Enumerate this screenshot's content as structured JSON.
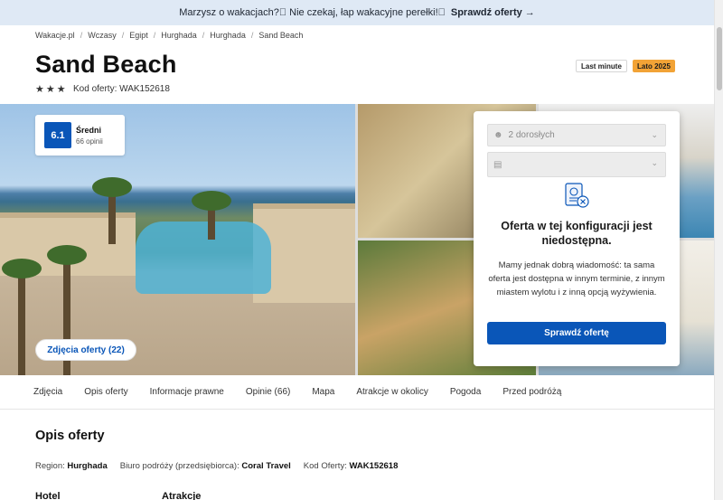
{
  "promo": {
    "text": "Marzysz o wakacjach?\u0000 Nie czekaj, łap wakacyjne perełki!\u0000",
    "link": "Sprawdź oferty →"
  },
  "breadcrumbs": [
    "Wakacje.pl",
    "Wczasy",
    "Egipt",
    "Hurghada",
    "Hurghada",
    "Sand Beach"
  ],
  "hotel": {
    "name": "Sand Beach",
    "stars": 3,
    "offer_code": "Kod oferty: WAK152618"
  },
  "tags": {
    "last_minute": "Last minute",
    "season": "Lato 2025"
  },
  "rating": {
    "score": "6.1",
    "label": "Średni",
    "count": "66 opinii"
  },
  "photos_button": "Zdjęcia oferty (22)",
  "panel": {
    "guests": "2 dorosłych",
    "date": "",
    "unavailable_title": "Oferta w tej konfiguracji jest niedostępna.",
    "unavailable_body": "Mamy jednak dobrą wiadomość: ta sama oferta jest dostępna w innym terminie, z innym miastem wylotu i z inną opcją wyżywienia.",
    "check_button": "Sprawdź ofertę"
  },
  "tabs": [
    "Zdjęcia",
    "Opis oferty",
    "Informacje prawne",
    "Opinie (66)",
    "Mapa",
    "Atrakcje w okolicy",
    "Pogoda",
    "Przed podróżą"
  ],
  "description": {
    "title": "Opis oferty",
    "region_label": "Region:",
    "region_value": "Hurghada",
    "agency_label": "Biuro podróży (przedsiębiorca):",
    "agency_value": "Coral Travel",
    "code_label": "Kod Oferty:",
    "code_value": "WAK152618",
    "sub_left": "Hotel",
    "sub_right": "Atrakcje"
  },
  "colors": {
    "primary": "#0a56b8",
    "season_tag": "#f2a336",
    "promo_bg": "#dfe9f5"
  }
}
